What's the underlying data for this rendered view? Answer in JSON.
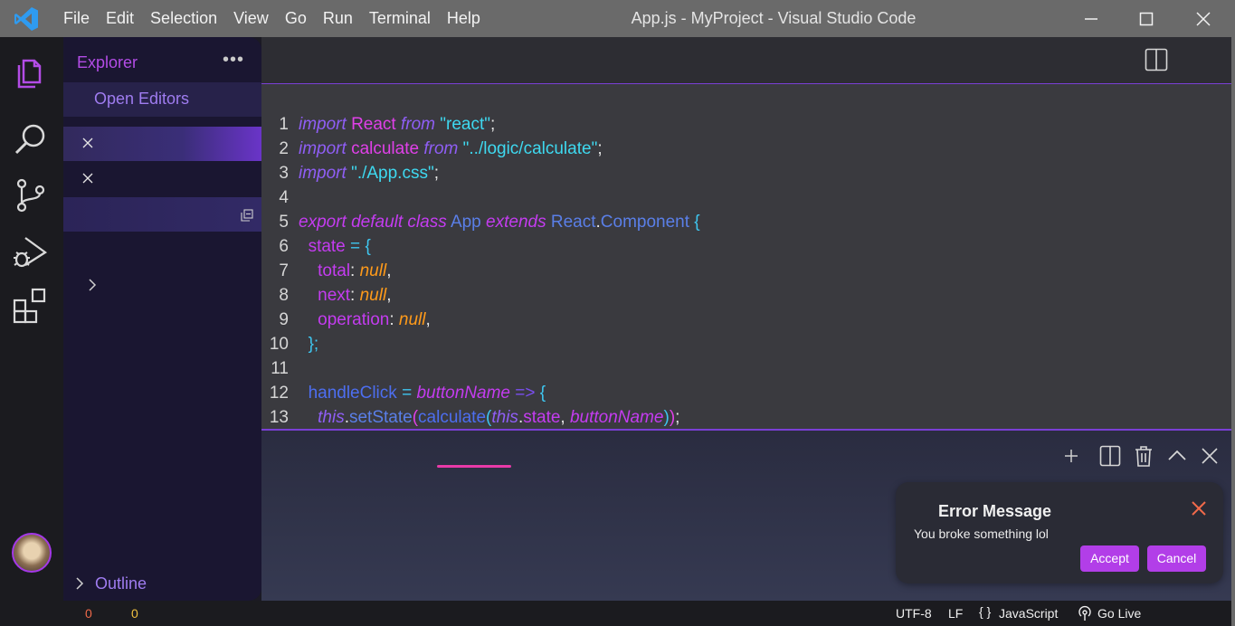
{
  "window": {
    "title": "App.js - MyProject - Visual Studio Code",
    "menu": [
      "File",
      "Edit",
      "Selection",
      "View",
      "Go",
      "Run",
      "Terminal",
      "Help"
    ]
  },
  "activity_bar": {
    "items": [
      "explorer-icon",
      "search-icon",
      "source-control-icon",
      "run-debug-icon",
      "extensions-icon"
    ],
    "accent": "#b34ce6"
  },
  "sidebar": {
    "title": "Explorer",
    "more": "•••",
    "open_editors": "Open Editors",
    "outline": "Outline"
  },
  "editor": {
    "lines": [
      "1",
      "2",
      "3",
      "4",
      "5",
      "6",
      "7",
      "8",
      "9",
      "10",
      "11",
      "12",
      "13"
    ]
  },
  "notification": {
    "title": "Error Message",
    "message": "You broke something lol",
    "accept": "Accept",
    "cancel": "Cancel"
  },
  "status_bar": {
    "errors": "0",
    "warnings": "0",
    "encoding": "UTF-8",
    "eol": "LF",
    "language_icon": "{ }",
    "language": "JavaScript",
    "go_live": "Go Live"
  }
}
